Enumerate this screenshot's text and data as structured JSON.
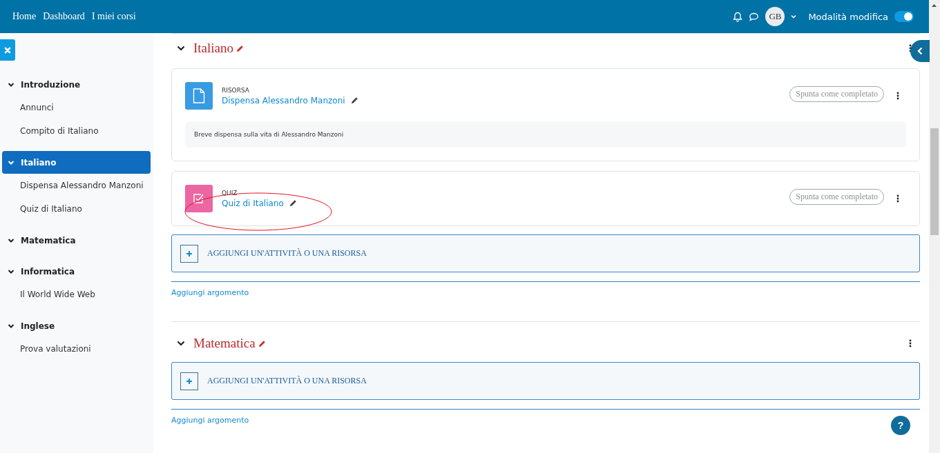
{
  "navbar": {
    "links": [
      "Home",
      "Dashboard",
      "I miei corsi"
    ],
    "avatar_initials": "GB",
    "edit_mode": {
      "label": "Modalità modifica",
      "on": true
    }
  },
  "course_index": {
    "sections": [
      {
        "title": "Introduzione",
        "expanded": true,
        "selected": false,
        "children": [
          {
            "title": "Annunci"
          },
          {
            "title": "Compito di Italiano"
          }
        ]
      },
      {
        "title": "Italiano",
        "expanded": true,
        "selected": true,
        "children": [
          {
            "title": "Dispensa Alessandro Manzoni"
          },
          {
            "title": "Quiz di Italiano"
          }
        ]
      },
      {
        "title": "Matematica",
        "expanded": true,
        "selected": false
      },
      {
        "title": "Informatica",
        "expanded": true,
        "selected": false,
        "children": [
          {
            "title": "Il World Wide Web"
          }
        ]
      },
      {
        "title": "Inglese",
        "expanded": true,
        "selected": false,
        "children": [
          {
            "title": "Prova valutazioni"
          }
        ]
      }
    ]
  },
  "sections": [
    {
      "title": "Italiano",
      "expanded": true,
      "activities": [
        {
          "kind": "resource",
          "type_label": "RISORSA",
          "name": "Dispensa Alessandro Manzoni",
          "completion": "Spunta come completato",
          "description": "Breve dispensa sulla vita di Alessandro Manzoni"
        },
        {
          "kind": "quiz",
          "type_label": "QUIZ",
          "name": "Quiz di Italiano",
          "completion": "Spunta come completato"
        }
      ],
      "add_activity": "AGGIUNGI UN'ATTIVITÀ O UNA RISORSA",
      "add_topic": "Aggiungi argomento"
    },
    {
      "title": "Matematica",
      "expanded": true,
      "add_activity": "AGGIUNGI UN'ATTIVITÀ O UNA RISORSA",
      "add_topic": "Aggiungi argomento"
    }
  ],
  "help_button": "?"
}
